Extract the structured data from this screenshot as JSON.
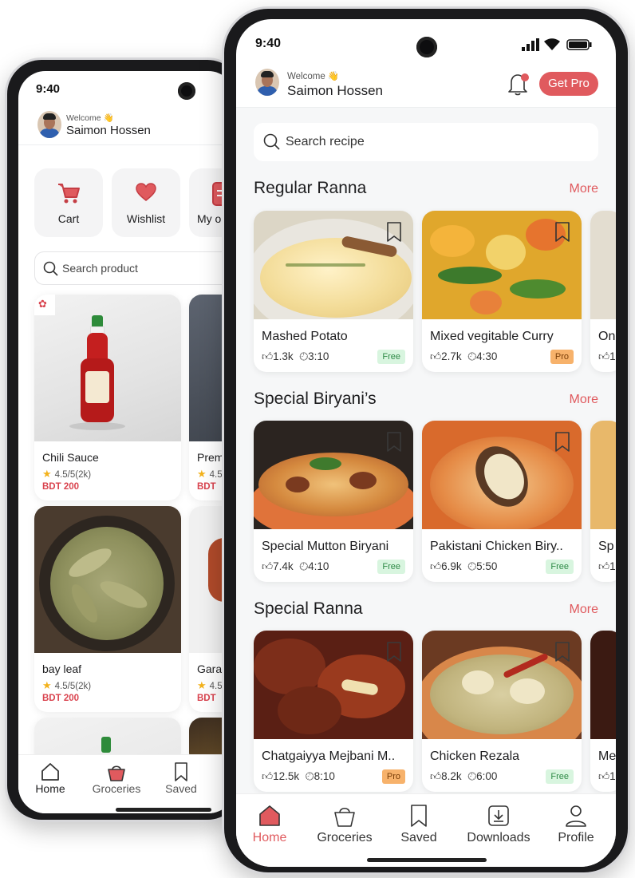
{
  "back_phone": {
    "status": {
      "time": "9:40"
    },
    "header": {
      "welcome": "Welcome 👋",
      "username": "Saimon Hossen"
    },
    "quick_actions": [
      {
        "label": "Cart",
        "icon": "cart-icon"
      },
      {
        "label": "Wishlist",
        "icon": "heart-icon"
      },
      {
        "label": "My o",
        "icon": "orders-icon"
      }
    ],
    "search": {
      "placeholder": "Search product"
    },
    "products": [
      {
        "name": "Chili Sauce",
        "rating": "4.5/5(2k)",
        "price": "BDT  200"
      },
      {
        "name": "Prem",
        "rating": "4.5",
        "price": "BDT"
      },
      {
        "name": "bay leaf",
        "rating": "4.5/5(2k)",
        "price": "BDT  200"
      },
      {
        "name": "Gara",
        "rating": "4.5",
        "price": "BDT"
      }
    ],
    "nav": [
      {
        "label": "Home",
        "icon": "home-icon"
      },
      {
        "label": "Groceries",
        "icon": "basket-icon"
      },
      {
        "label": "Saved",
        "icon": "bookmark-icon"
      }
    ]
  },
  "front_phone": {
    "status": {
      "time": "9:40"
    },
    "header": {
      "welcome": "Welcome 👋",
      "username": "Saimon Hossen",
      "cta": "Get Pro"
    },
    "search": {
      "placeholder": "Search recipe"
    },
    "sections": [
      {
        "title": "Regular Ranna",
        "more": "More",
        "cards": [
          {
            "name": "Mashed Potato",
            "likes": "1.3k",
            "time": "3:10",
            "badge": "Free"
          },
          {
            "name": "Mixed vegitable Curry",
            "likes": "2.7k",
            "time": "4:30",
            "badge": "Pro"
          },
          {
            "name": "On",
            "likes": "1",
            "time": "",
            "badge": ""
          }
        ]
      },
      {
        "title": "Special Biryani’s",
        "more": "More",
        "cards": [
          {
            "name": "Special Mutton Biryani",
            "likes": "7.4k",
            "time": "4:10",
            "badge": "Free"
          },
          {
            "name": "Pakistani Chicken Biry..",
            "likes": "6.9k",
            "time": "5:50",
            "badge": "Free"
          },
          {
            "name": "Sp",
            "likes": "1",
            "time": "",
            "badge": ""
          }
        ]
      },
      {
        "title": "Special Ranna",
        "more": "More",
        "cards": [
          {
            "name": "Chatgaiyya Mejbani M..",
            "likes": "12.5k",
            "time": "8:10",
            "badge": "Pro"
          },
          {
            "name": "Chicken Rezala",
            "likes": "8.2k",
            "time": "6:00",
            "badge": "Free"
          },
          {
            "name": "Me",
            "likes": "1",
            "time": "",
            "badge": ""
          }
        ]
      }
    ],
    "nav": [
      {
        "label": "Home",
        "icon": "home-icon"
      },
      {
        "label": "Groceries",
        "icon": "basket-icon"
      },
      {
        "label": "Saved",
        "icon": "bookmark-icon"
      },
      {
        "label": "Downloads",
        "icon": "download-icon"
      },
      {
        "label": "Profile",
        "icon": "profile-icon"
      }
    ]
  },
  "colors": {
    "accent": "#e05a5e",
    "free_badge": "#d8f5df",
    "pro_badge": "#f7b26b",
    "price": "#d9434e"
  }
}
